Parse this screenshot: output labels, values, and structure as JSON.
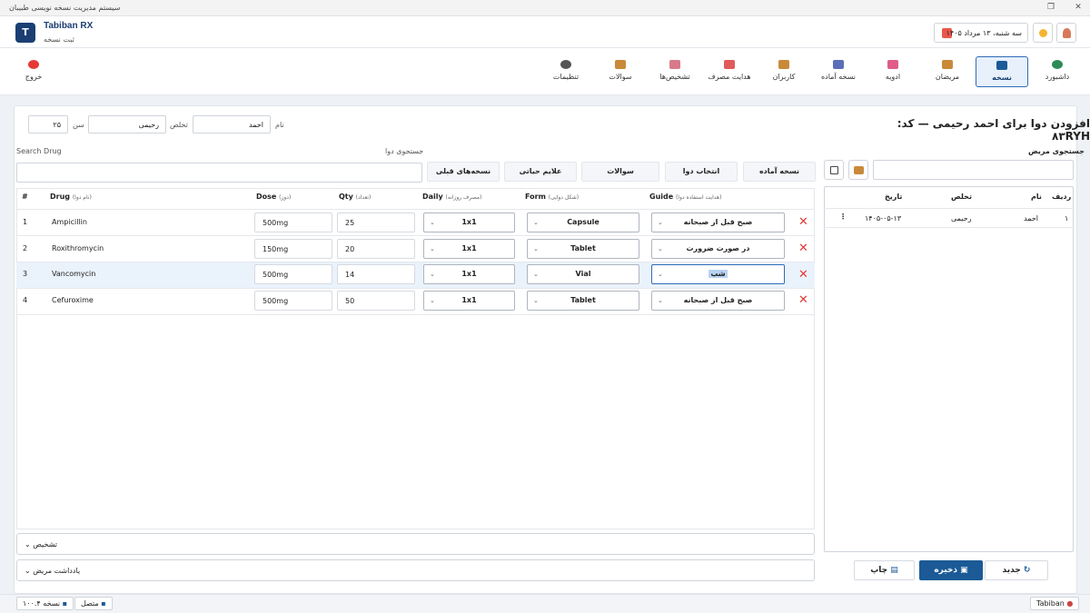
{
  "window": {
    "title": "سیستم مدیریت نسخه نویسی طبیبان"
  },
  "app": {
    "name": "Tabiban RX",
    "subtitle": "ثبت نسخه",
    "logo": "T"
  },
  "header": {
    "date": "سه شنبه، ۱۳ مرداد ۱۴۰۵"
  },
  "nav": [
    {
      "label": "داشبورد",
      "icon": "dashboard-icon"
    },
    {
      "label": "نسخه",
      "icon": "cart-icon",
      "active": true
    },
    {
      "label": "مریضان",
      "icon": "patients-icon"
    },
    {
      "label": "ادویه",
      "icon": "pill-icon"
    },
    {
      "label": "نسخه آماده",
      "icon": "document-icon"
    },
    {
      "label": "کاربران",
      "icon": "users-icon"
    },
    {
      "label": "هدایت مصرف",
      "icon": "calendar-icon"
    },
    {
      "label": "تشخیص‌ها",
      "icon": "diagnosis-icon"
    },
    {
      "label": "سوالات",
      "icon": "questions-icon"
    },
    {
      "label": "تنظیمات",
      "icon": "gear-icon"
    }
  ],
  "logout": "خروج",
  "form": {
    "heading": "افزودن دوا برای احمد رحیمی — کد: ۸۳RYH",
    "name_label": "نام",
    "name_value": "احمد",
    "surname_label": "تخلص",
    "surname_value": "رحیمی",
    "age_label": "سن",
    "age_value": "۲۵"
  },
  "search": {
    "drug_label_en": "Search Drug",
    "drug_label_fa": "جستجوی دوا",
    "patient_label": "جستجوی مریض"
  },
  "actions": [
    "نسخه آماده",
    "انتخاب دوا",
    "سوالات",
    "علایم حیاتی",
    "نسخه‌های قبلی"
  ],
  "table": {
    "headers": {
      "num": "#",
      "drug": "Drug",
      "drug_sub": "(نام دوا)",
      "dose": "Dose",
      "dose_sub": "(دوز)",
      "qty": "Qty",
      "qty_sub": "(تعداد)",
      "daily": "Daily",
      "daily_sub": "(مصرف روزانه)",
      "form": "Form",
      "form_sub": "(شکل دوایی)",
      "guide": "Guide",
      "guide_sub": "(هدایت استفاده دوا)"
    },
    "rows": [
      {
        "num": "1",
        "drug": "Ampicillin",
        "dose": "500mg",
        "qty": "25",
        "daily": "1x1",
        "form": "Capsule",
        "guide": "صبح قبل از صبحانه"
      },
      {
        "num": "2",
        "drug": "Roxithromycin",
        "dose": "150mg",
        "qty": "20",
        "daily": "1x1",
        "form": "Tablet",
        "guide": "در صورت ضرورت"
      },
      {
        "num": "3",
        "drug": "Vancomycin",
        "dose": "500mg",
        "qty": "14",
        "daily": "1x1",
        "form": "Vial",
        "guide": "شب"
      },
      {
        "num": "4",
        "drug": "Cefuroxime",
        "dose": "500mg",
        "qty": "50",
        "daily": "1x1",
        "form": "Tablet",
        "guide": "صبح قبل از صبحانه"
      }
    ]
  },
  "accordions": [
    "تشخیص",
    "یادداشت مریض"
  ],
  "side_table": {
    "headers": {
      "row": "ردیف",
      "name": "نام",
      "surname": "تخلص",
      "date": "تاریخ"
    },
    "rows": [
      {
        "row": "۱",
        "name": "احمد",
        "surname": "رحیمی",
        "date": "۱۴۰۵-۰۵-۱۳"
      }
    ]
  },
  "buttons": {
    "new": "جدید",
    "save": "ذخیره",
    "print": "چاپ"
  },
  "status": {
    "brand": "Tabiban",
    "connected": "متصل",
    "version": "نسخه ۱۰۰.۴"
  },
  "colors": {
    "primary": "#1b5a96",
    "danger": "#e53935",
    "accent": "#2e6cb8"
  }
}
